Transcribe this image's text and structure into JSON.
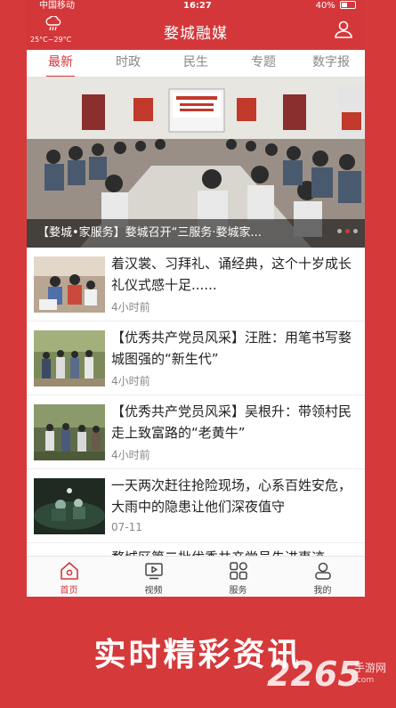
{
  "status_bar": {
    "carrier": "中国移动",
    "time": "16:27",
    "battery": "40%",
    "battery_level": 0.4
  },
  "header": {
    "title": "婺城融媒",
    "temperature": "25°C~29°C",
    "weather_icon": "cloud-rain-icon",
    "user_icon": "user-icon"
  },
  "tabs": [
    {
      "label": "最新",
      "active": true
    },
    {
      "label": "时政",
      "active": false
    },
    {
      "label": "民生",
      "active": false
    },
    {
      "label": "专题",
      "active": false
    },
    {
      "label": "数字报",
      "active": false
    }
  ],
  "banner": {
    "caption": "【婺城•家服务】婺城召开“三服务·婺城家...",
    "slide_count": 3,
    "active_slide": 2
  },
  "news": [
    {
      "headline": "着汉裳、习拜礼、诵经典，这个十岁成长礼仪式感十足......",
      "time": "4小时前"
    },
    {
      "headline": "【优秀共产党员风采】汪胜：用笔书写婺城图强的“新生代”",
      "time": "4小时前"
    },
    {
      "headline": "【优秀共产党员风采】吴根升：带领村民走上致富路的“老黄牛”",
      "time": "4小时前"
    },
    {
      "headline": "一天两次赶往抢险现场，心系百姓安危，大雨中的隐患让他们深夜值守",
      "time": "07-11"
    }
  ],
  "partial_news_headline": "婺城区第二批优秀共产党员先进事迹",
  "bottom_nav": [
    {
      "label": "首页",
      "icon": "home-icon",
      "active": true
    },
    {
      "label": "视频",
      "icon": "video-icon",
      "active": false
    },
    {
      "label": "服务",
      "icon": "grid-icon",
      "active": false
    },
    {
      "label": "我的",
      "icon": "user-icon",
      "active": false
    }
  ],
  "slogan": "实时精彩资讯",
  "watermark": {
    "big": "2265",
    "small1": "手游网",
    "small2": ".com"
  },
  "colors": {
    "brand": "#d4373a",
    "background": "#d6393a"
  }
}
